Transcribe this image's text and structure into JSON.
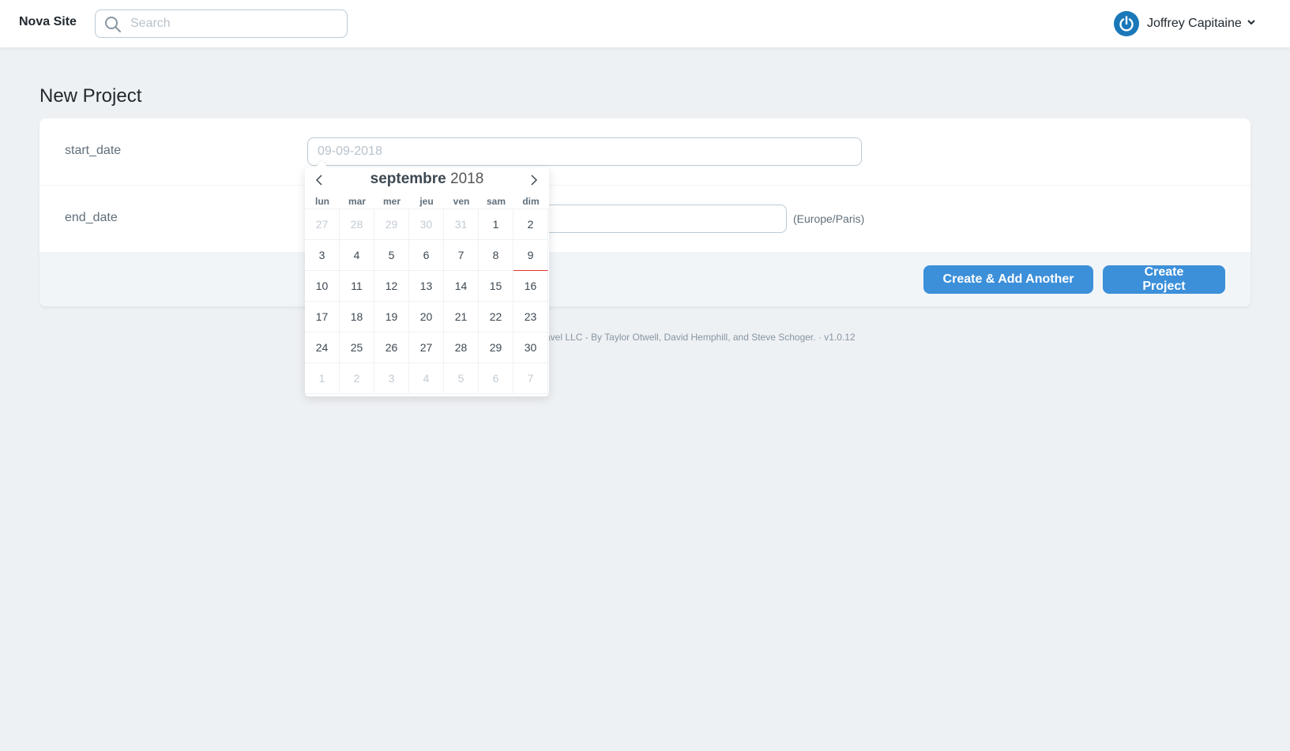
{
  "header": {
    "brand": "Nova Site",
    "search_placeholder": "Search",
    "user_name": "Joffrey Capitaine"
  },
  "page": {
    "title": "New Project"
  },
  "form": {
    "start_date": {
      "label": "start_date",
      "placeholder": "09-09-2018",
      "value": ""
    },
    "end_date": {
      "label": "end_date",
      "value": "",
      "timezone": "(Europe/Paris)"
    },
    "buttons": {
      "create_another": "Create & Add Another",
      "create": "Create Project"
    }
  },
  "footer": {
    "text": "avel LLC - By Taylor Otwell, David Hemphill, and Steve Schoger.  ·  v1.0.12"
  },
  "datepicker": {
    "month": "septembre",
    "year": "2018",
    "weekdays": [
      "lun",
      "mar",
      "mer",
      "jeu",
      "ven",
      "sam",
      "dim"
    ],
    "weeks": [
      [
        {
          "d": "27",
          "o": true
        },
        {
          "d": "28",
          "o": true
        },
        {
          "d": "29",
          "o": true
        },
        {
          "d": "30",
          "o": true
        },
        {
          "d": "31",
          "o": true
        },
        {
          "d": "1"
        },
        {
          "d": "2"
        }
      ],
      [
        {
          "d": "3"
        },
        {
          "d": "4"
        },
        {
          "d": "5"
        },
        {
          "d": "6"
        },
        {
          "d": "7"
        },
        {
          "d": "8"
        },
        {
          "d": "9",
          "today": true
        }
      ],
      [
        {
          "d": "10"
        },
        {
          "d": "11"
        },
        {
          "d": "12"
        },
        {
          "d": "13"
        },
        {
          "d": "14"
        },
        {
          "d": "15"
        },
        {
          "d": "16"
        }
      ],
      [
        {
          "d": "17"
        },
        {
          "d": "18"
        },
        {
          "d": "19"
        },
        {
          "d": "20"
        },
        {
          "d": "21"
        },
        {
          "d": "22"
        },
        {
          "d": "23"
        }
      ],
      [
        {
          "d": "24"
        },
        {
          "d": "25"
        },
        {
          "d": "26"
        },
        {
          "d": "27"
        },
        {
          "d": "28"
        },
        {
          "d": "29"
        },
        {
          "d": "30"
        }
      ],
      [
        {
          "d": "1",
          "o": true
        },
        {
          "d": "2",
          "o": true
        },
        {
          "d": "3",
          "o": true
        },
        {
          "d": "4",
          "o": true
        },
        {
          "d": "5",
          "o": true
        },
        {
          "d": "6",
          "o": true
        },
        {
          "d": "7",
          "o": true
        }
      ]
    ]
  },
  "colors": {
    "accent": "#3c8fd9",
    "avatar": "#1a78b8",
    "today_marker": "#e3342f"
  }
}
